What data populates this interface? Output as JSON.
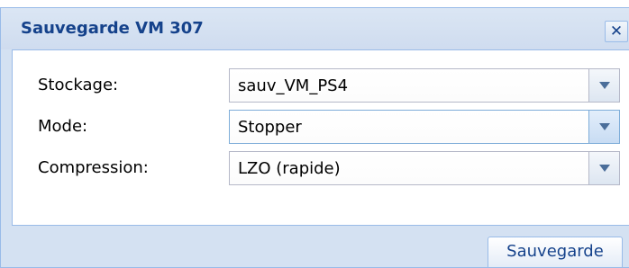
{
  "dialog": {
    "title": "Sauvegarde VM 307",
    "close_label": "✕",
    "fields": [
      {
        "label": "Stockage:",
        "value": "sauv_VM_PS4"
      },
      {
        "label": "Mode:",
        "value": "Stopper"
      },
      {
        "label": "Compression:",
        "value": "LZO (rapide)"
      }
    ],
    "save_label": "Sauvegarde"
  },
  "icons": {
    "close": "close-icon",
    "dropdown": "chevron-down-icon"
  },
  "colors": {
    "title": "#15428b",
    "window_bg": "#d4e1f2",
    "border": "#99bbe8",
    "field_border": "#b5b8c8",
    "focus_border": "#7eadd9"
  }
}
